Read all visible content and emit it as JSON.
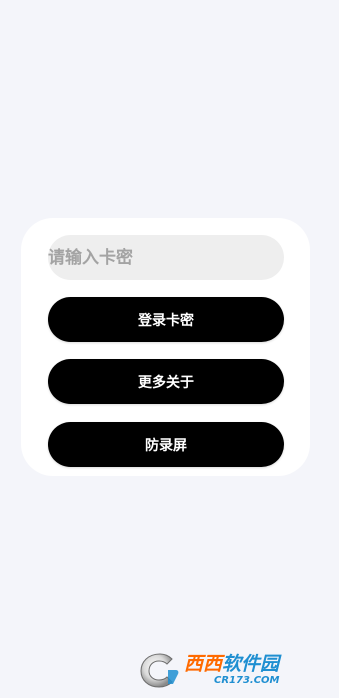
{
  "login": {
    "input_placeholder": "请输入卡密",
    "input_value": "",
    "login_button_label": "登录卡密",
    "more_button_label": "更多关于",
    "anti_record_button_label": "防录屏"
  },
  "watermark": {
    "brand_main": "西西",
    "brand_sub": "软件园",
    "domain": "CR173.COM"
  },
  "colors": {
    "background": "#f4f5fa",
    "card": "#ffffff",
    "input_bg": "#eeeeee",
    "placeholder": "#a3a3a3",
    "button_bg": "#000000",
    "button_text": "#ffffff"
  },
  "icons": {
    "watermark_logo": "cr-logo-icon"
  }
}
